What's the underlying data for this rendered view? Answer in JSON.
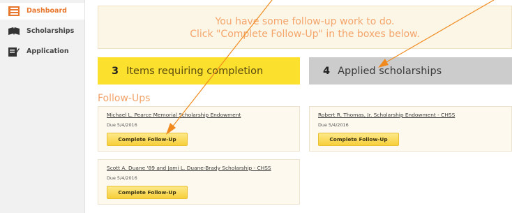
{
  "sidebar": {
    "items": [
      {
        "label": "Dashboard",
        "icon": "dashboard-icon",
        "active": true
      },
      {
        "label": "Scholarships",
        "icon": "book-icon",
        "active": false
      },
      {
        "label": "Application",
        "icon": "application-icon",
        "active": false
      }
    ]
  },
  "banner": {
    "line1": "You have some follow-up work to do.",
    "line2": "Click \"Complete Follow-Up\" in the boxes below."
  },
  "stats": {
    "items_requiring": {
      "count": "3",
      "label": "Items requiring completion"
    },
    "applied": {
      "count": "4",
      "label": "Applied scholarships"
    }
  },
  "followups": {
    "title": "Follow-Ups",
    "cards": [
      {
        "name": "Michael L. Pearce Memorial Scholarship Endowment",
        "due": "Due 5/4/2016",
        "button": "Complete Follow-Up"
      },
      {
        "name": "Robert R. Thomas, Jr. Scholarship Endowment - CHSS",
        "due": "Due 5/4/2016",
        "button": "Complete Follow-Up"
      },
      {
        "name": "Scott A. Duane '89 and Jami L. Duane-Brady Scholarship - CHSS",
        "due": "Due 5/4/2016",
        "button": "Complete Follow-Up"
      }
    ]
  },
  "colors": {
    "accent_orange": "#e8772e",
    "stat_yellow": "#fbe12d",
    "stat_gray": "#cccccc",
    "arrow_orange": "#f08a1e"
  }
}
